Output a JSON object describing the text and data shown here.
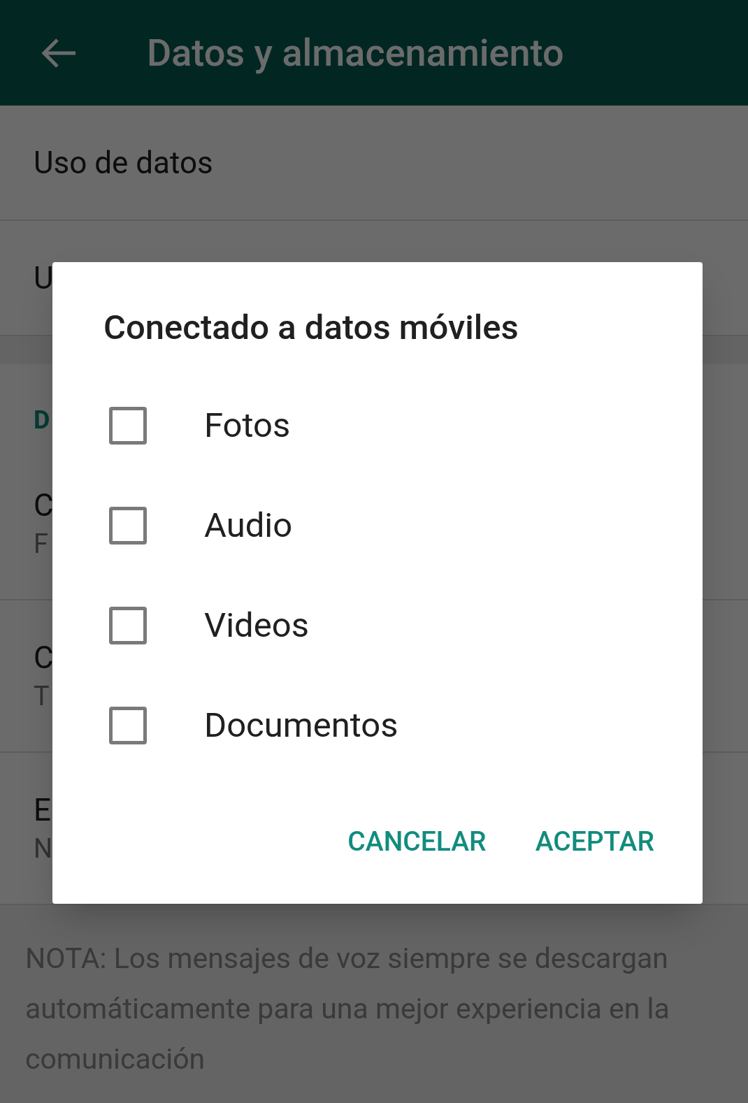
{
  "app_bar": {
    "title": "Datos y almacenamiento"
  },
  "rows": [
    {
      "title": "Uso de datos"
    },
    {
      "title": "U"
    }
  ],
  "section": {
    "header": "D",
    "rows": [
      {
        "title": "C",
        "subtitle": "F"
      },
      {
        "title": "C",
        "subtitle": "T"
      },
      {
        "title": "E",
        "subtitle": "N"
      }
    ]
  },
  "note": "NOTA: Los mensajes de voz siempre se descargan automáticamente para una mejor experiencia en la comunicación",
  "dialog": {
    "title": "Conectado a datos móviles",
    "options": [
      {
        "label": "Fotos",
        "checked": false
      },
      {
        "label": "Audio",
        "checked": false
      },
      {
        "label": "Videos",
        "checked": false
      },
      {
        "label": "Documentos",
        "checked": false
      }
    ],
    "buttons": [
      "CANCELAR",
      "ACEPTAR"
    ]
  }
}
